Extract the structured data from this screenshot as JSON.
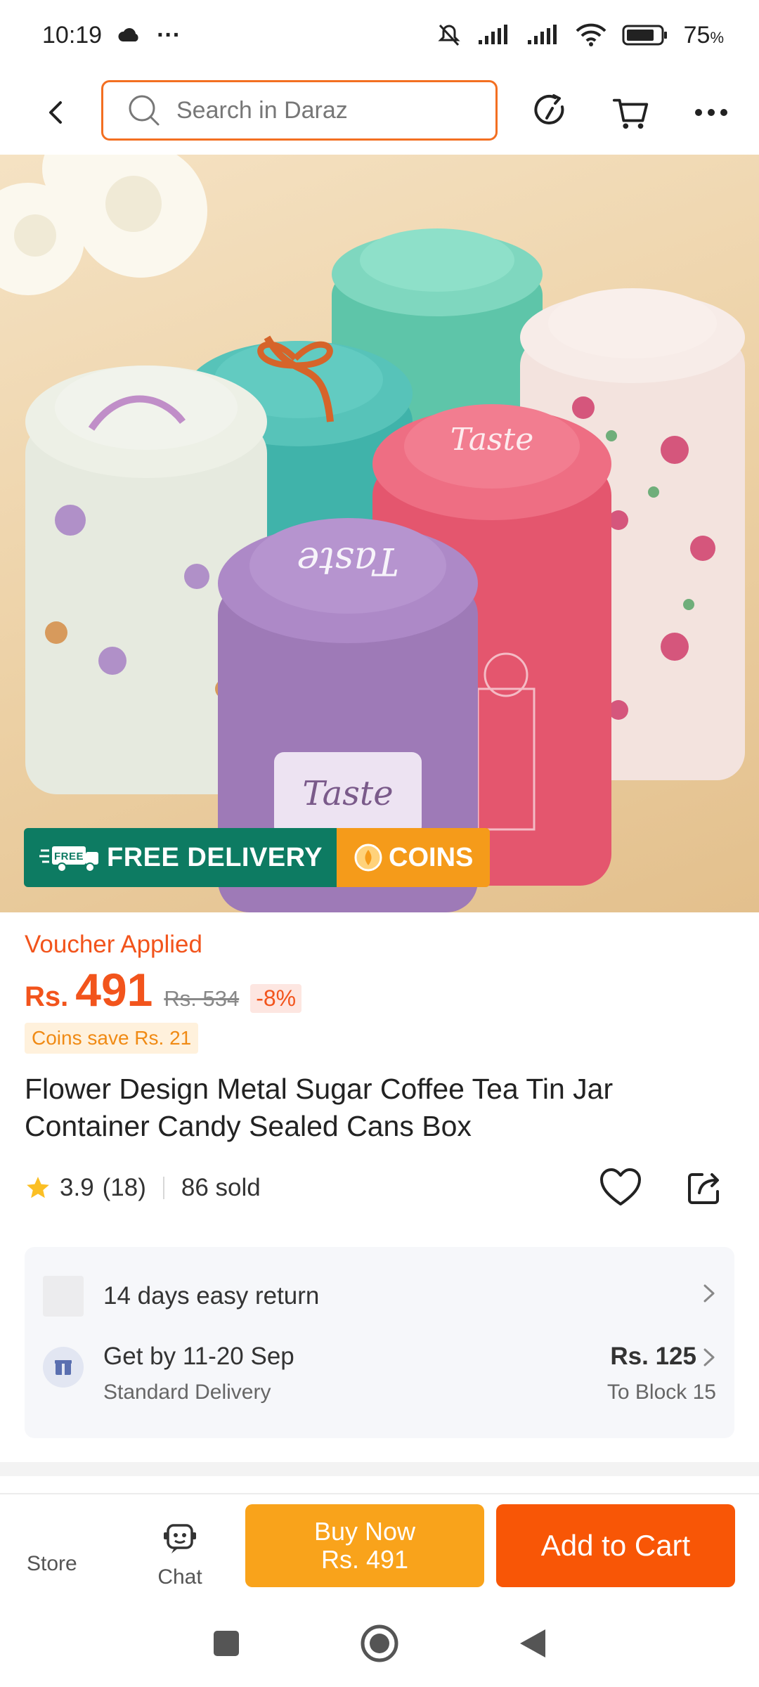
{
  "status_bar": {
    "time": "10:19",
    "dots": "···",
    "battery": "75"
  },
  "search": {
    "placeholder": "Search in Daraz"
  },
  "badges": {
    "delivery_tag": "FREE",
    "delivery": "FREE DELIVERY",
    "coins": "COINS"
  },
  "product": {
    "voucher": "Voucher Applied",
    "currency": "Rs.",
    "price": "491",
    "old_price": "Rs. 534",
    "discount": "-8%",
    "coins_save": "Coins save Rs. 21",
    "title": "Flower Design Metal Sugar Coffee Tea Tin Jar Container Candy Sealed Cans Box",
    "rating": "3.9",
    "reviews": "(18)",
    "sold": "86 sold"
  },
  "service": {
    "return": "14 days easy return",
    "delivery_date": "Get by 11-20 Sep",
    "delivery_type": "Standard Delivery",
    "delivery_price": "Rs. 125",
    "delivery_location": "To Block 15"
  },
  "bottom_bar": {
    "store": "Store",
    "chat": "Chat",
    "buy_now": "Buy Now",
    "buy_now_price": "Rs. 491",
    "add_to_cart": "Add to Cart"
  },
  "colors": {
    "accent": "#f85606",
    "buy_now": "#f9a31b",
    "delivery_badge": "#0d7b62",
    "coins_badge": "#f59b1a"
  }
}
